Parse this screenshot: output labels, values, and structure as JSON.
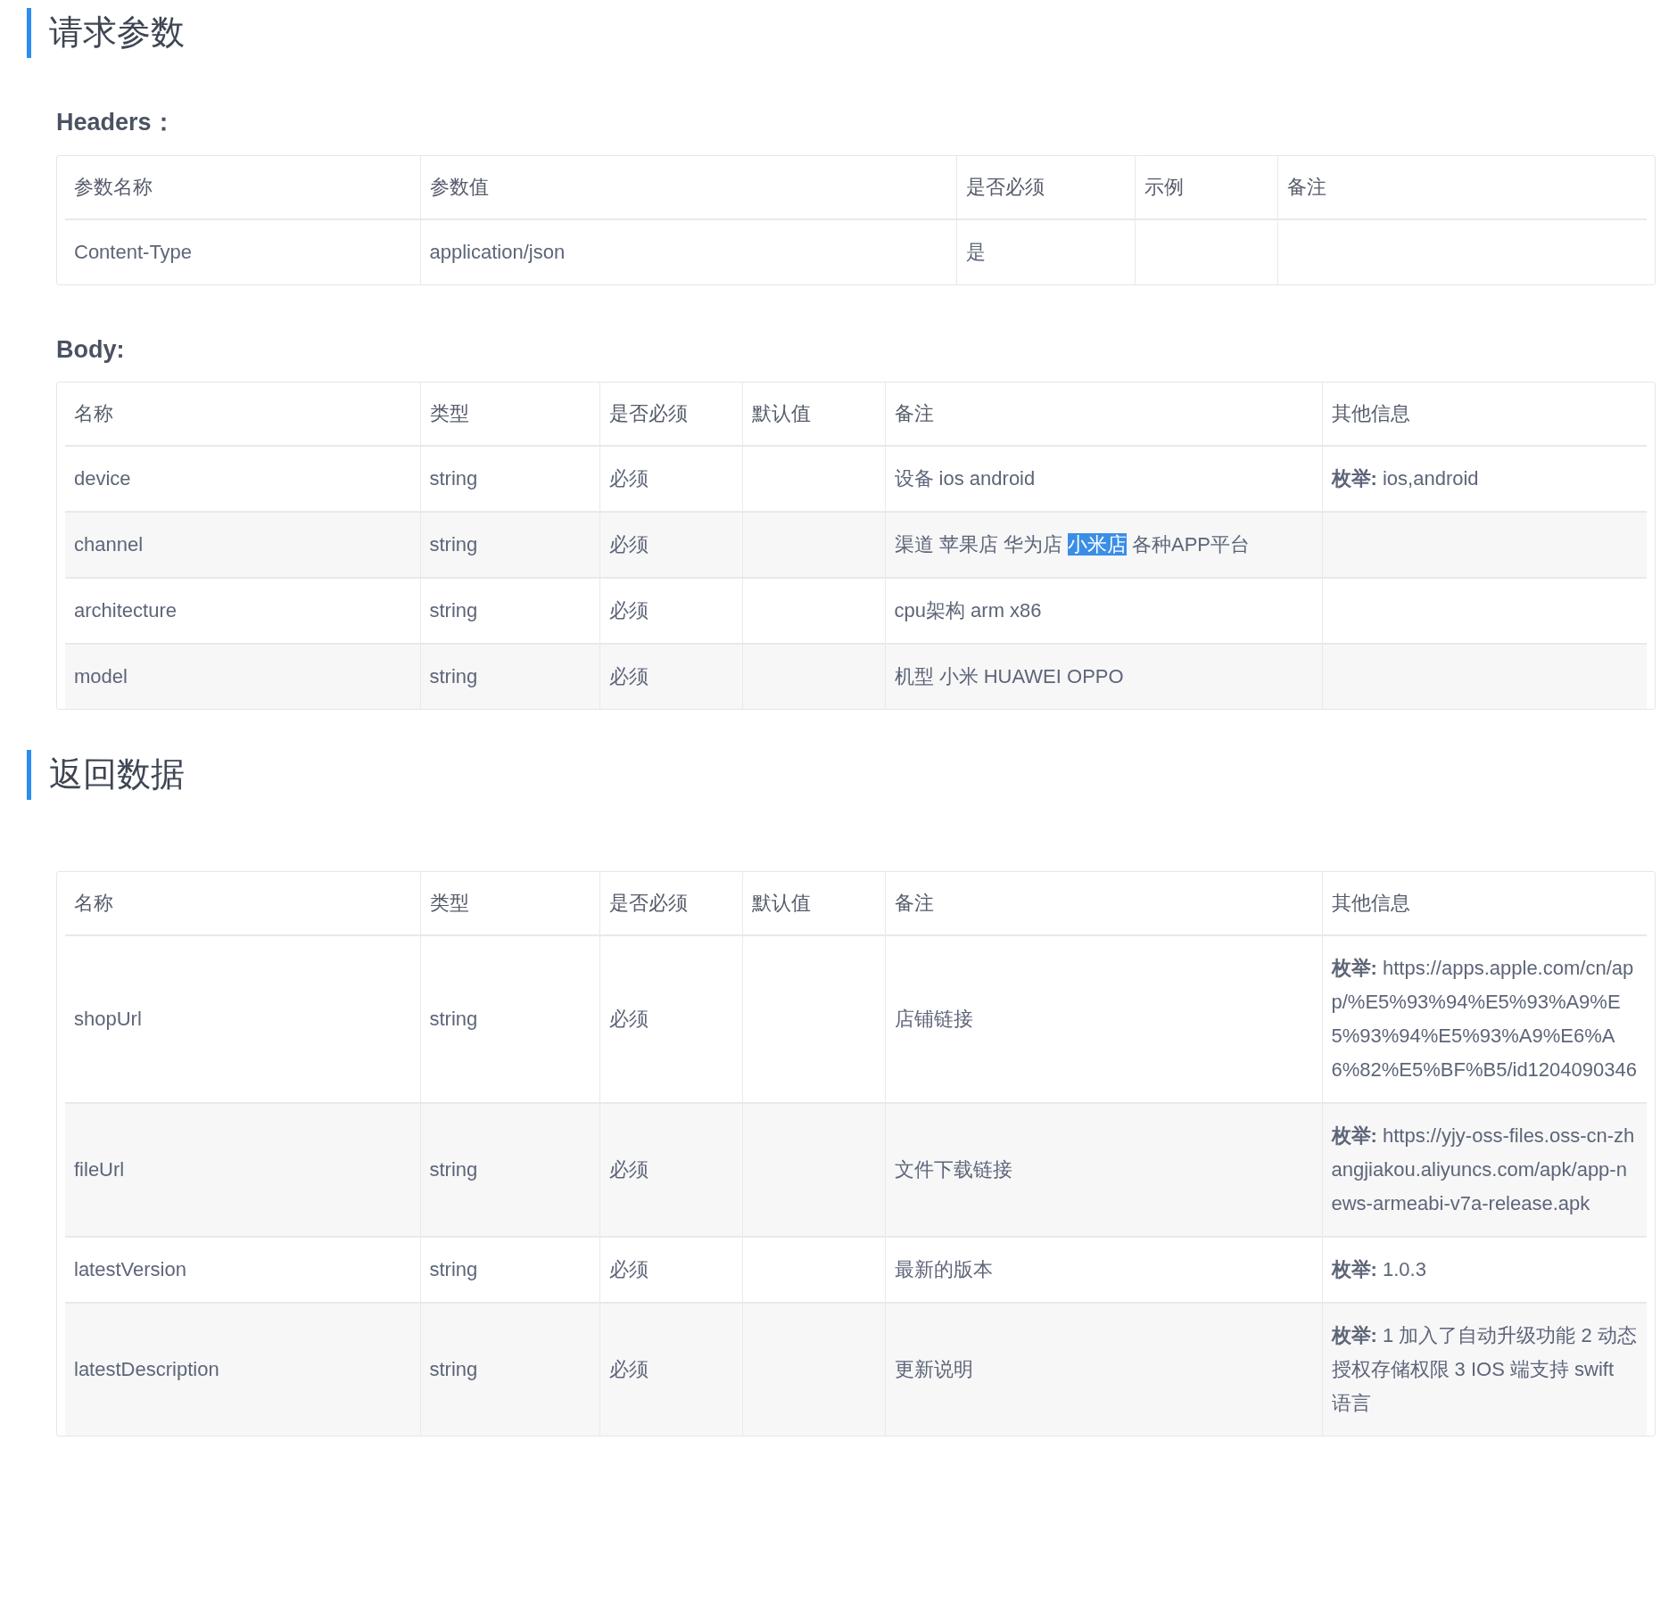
{
  "sections": [
    {
      "title": "请求参数",
      "tables": [
        {
          "label": "Headers：",
          "columns": [
            "参数名称",
            "参数值",
            "是否必须",
            "示例",
            "备注"
          ],
          "rows": [
            [
              "Content-Type",
              "application/json",
              "是",
              "",
              ""
            ]
          ]
        },
        {
          "label": "Body:",
          "columns": [
            "名称",
            "类型",
            "是否必须",
            "默认值",
            "备注",
            "其他信息"
          ],
          "rows": [
            [
              "device",
              "string",
              "必须",
              "",
              "设备 ios android",
              "**枚举:** ios,android"
            ],
            [
              "channel",
              "string",
              "必须",
              "",
              {
                "segments": [
                  {
                    "text": "渠道 苹果店 华为店 ",
                    "selected": false
                  },
                  {
                    "text": "小米店",
                    "selected": true
                  },
                  {
                    "text": " 各种APP平台",
                    "selected": false
                  }
                ]
              },
              ""
            ],
            [
              "architecture",
              "string",
              "必须",
              "",
              "cpu架构 arm x86",
              ""
            ],
            [
              "model",
              "string",
              "必须",
              "",
              "机型 小米 HUAWEI OPPO",
              ""
            ]
          ]
        }
      ]
    },
    {
      "title": "返回数据",
      "tables": [
        {
          "columns": [
            "名称",
            "类型",
            "是否必须",
            "默认值",
            "备注",
            "其他信息"
          ],
          "rows": [
            [
              "shopUrl",
              "string",
              "必须",
              "",
              "店铺链接",
              "**枚举:** https://apps.apple.com/cn/app/%E5%93%94%E5%93%A9%E5%93%94%E5%93%A9%E6%A6%82%E5%BF%B5/id1204090346"
            ],
            [
              "fileUrl",
              "string",
              "必须",
              "",
              "文件下载链接",
              "**枚举:** https://yjy-oss-files.oss-cn-zhangjiakou.aliyuncs.com/apk/app-news-armeabi-v7a-release.apk"
            ],
            [
              "latestVersion",
              "string",
              "必须",
              "",
              "最新的版本",
              "**枚举:** 1.0.3"
            ],
            [
              "latestDescription",
              "string",
              "必须",
              "",
              "更新说明",
              "**枚举:** 1 加入了自动升级功能 2 动态授权存储权限 3 IOS 端支持 swift 语言"
            ]
          ]
        }
      ]
    }
  ]
}
